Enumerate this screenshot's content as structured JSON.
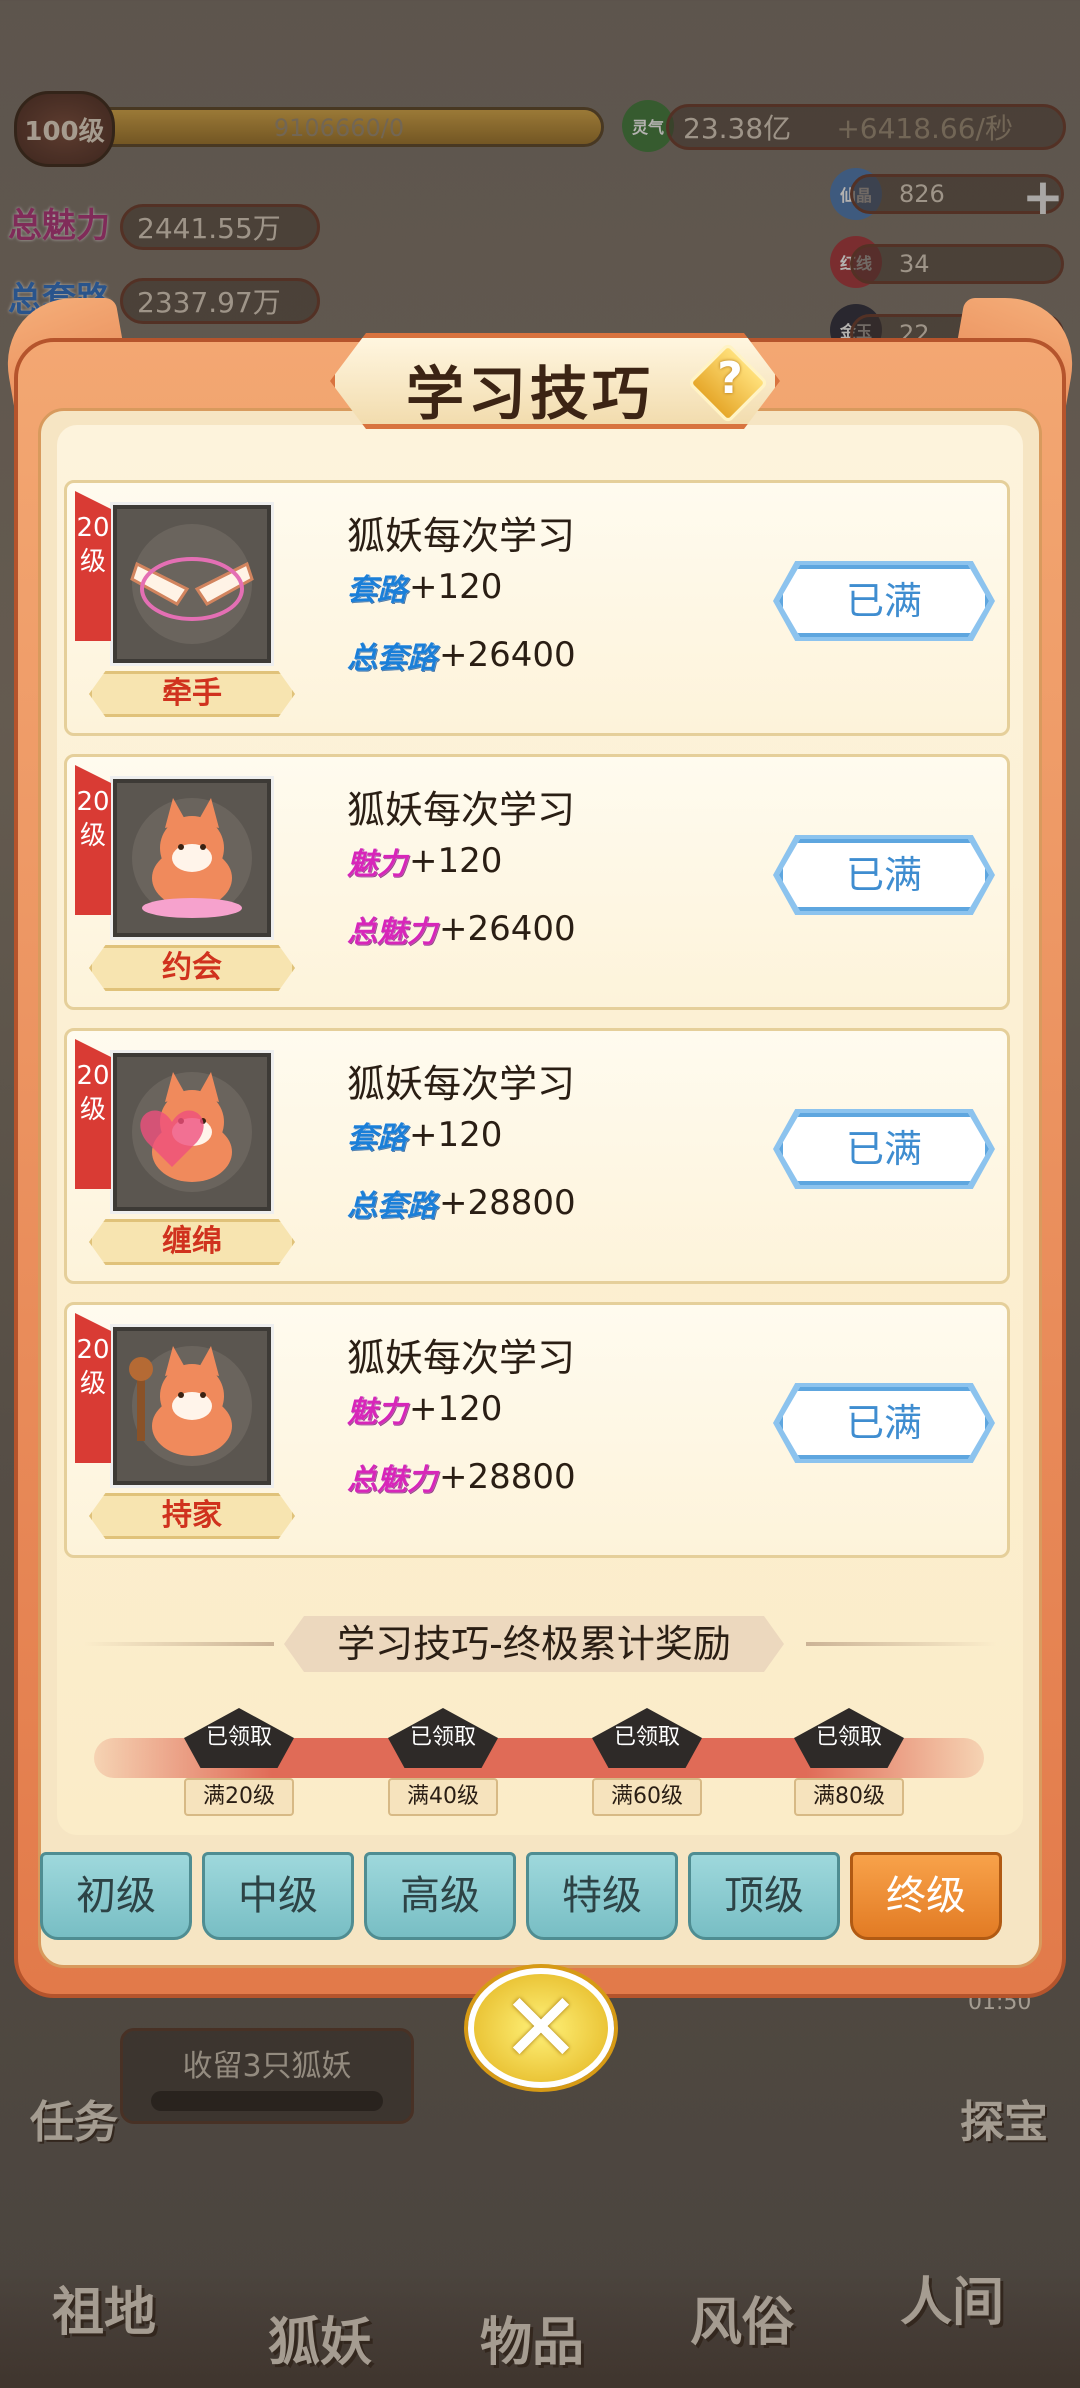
{
  "hud": {
    "level": "100级",
    "exp": "9106660/0",
    "total_charm_label": "总魅力",
    "total_charm": "2441.55万",
    "total_routine_label": "总套路",
    "total_routine": "2337.97万",
    "lingqi_label": "灵气",
    "lingqi": "23.38亿",
    "lingqi_rate": "+6418.66/秒",
    "resources": [
      {
        "label": "仙晶",
        "value": "826",
        "icon": "crystal-icon"
      },
      {
        "label": "红线",
        "value": "34",
        "icon": "red-thread-icon"
      },
      {
        "label": "金玉",
        "value": "22",
        "icon": "jade-icon"
      }
    ],
    "plus": "+"
  },
  "modal": {
    "title": "学习技巧",
    "help": "?",
    "skills": [
      {
        "level": "20级",
        "name": "牵手",
        "heading": "狐妖每次学习",
        "stat1_tag": "套路",
        "stat1_val": "+120",
        "stat2_tag": "总套路",
        "stat2_val": "+26400",
        "button": "已满",
        "tag_color": "blue",
        "art": "holding-hands-icon"
      },
      {
        "level": "20级",
        "name": "约会",
        "heading": "狐妖每次学习",
        "stat1_tag": "魅力",
        "stat1_val": "+120",
        "stat2_tag": "总魅力",
        "stat2_val": "+26400",
        "button": "已满",
        "tag_color": "pink",
        "art": "fox-date-icon"
      },
      {
        "level": "20级",
        "name": "缠绵",
        "heading": "狐妖每次学习",
        "stat1_tag": "套路",
        "stat1_val": "+120",
        "stat2_tag": "总套路",
        "stat2_val": "+28800",
        "button": "已满",
        "tag_color": "blue",
        "art": "fox-heart-icon"
      },
      {
        "level": "20级",
        "name": "持家",
        "heading": "狐妖每次学习",
        "stat1_tag": "魅力",
        "stat1_val": "+120",
        "stat2_tag": "总魅力",
        "stat2_val": "+28800",
        "button": "已满",
        "tag_color": "pink",
        "art": "fox-housekeeping-icon"
      }
    ],
    "reward_title": "学习技巧-终极累计奖励",
    "rewards": [
      {
        "status": "已领取",
        "req": "满20级"
      },
      {
        "status": "已领取",
        "req": "满40级"
      },
      {
        "status": "已领取",
        "req": "满60级"
      },
      {
        "status": "已领取",
        "req": "满80级"
      }
    ],
    "tabs": [
      "初级",
      "中级",
      "高级",
      "特级",
      "顶级",
      "终级"
    ],
    "active_tab": "终级"
  },
  "bottom": {
    "task_text": "收留3只狐妖",
    "task_label": "任务",
    "treasure_label": "探宝",
    "timer": "01:50",
    "nav": [
      "祖地",
      "狐妖",
      "物品",
      "风俗",
      "人间"
    ]
  },
  "colors": {
    "accent_orange": "#e27b24",
    "full_button_blue": "#3f8dd0",
    "routine_blue": "#1b7fd8",
    "charm_pink": "#d726b9",
    "level_ribbon_red": "#d93b34"
  }
}
